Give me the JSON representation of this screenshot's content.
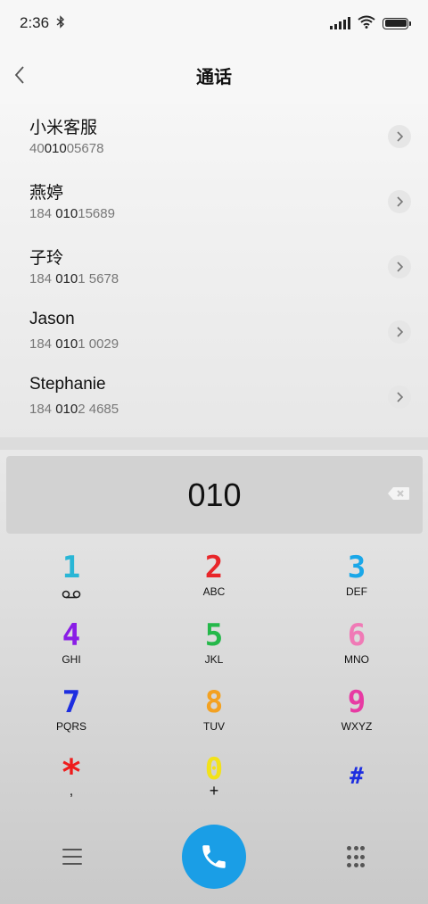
{
  "status_bar": {
    "time": "2:36",
    "bluetooth_icon": "bluetooth-icon",
    "signal_icon": "signal-icon",
    "wifi_icon": "wifi-icon",
    "battery_icon": "battery-icon",
    "battery_level": 1.0
  },
  "header": {
    "title": "通话",
    "back_icon": "chevron-left-icon"
  },
  "contacts": [
    {
      "name": "小米客服",
      "number_parts": [
        "40",
        "010",
        "05678"
      ]
    },
    {
      "name": "燕婷",
      "number_parts": [
        "184 ",
        "010",
        "15689"
      ]
    },
    {
      "name": "子玲",
      "number_parts": [
        "184 ",
        "010",
        "1 5678"
      ]
    },
    {
      "name": "Jason",
      "number_parts": [
        "184 ",
        "010",
        "1 0029"
      ]
    },
    {
      "name": "Stephanie",
      "number_parts": [
        "184 ",
        "010",
        "2 4685"
      ]
    }
  ],
  "dialer": {
    "dialed": "010",
    "backspace_icon": "backspace-icon",
    "keys": [
      {
        "digit": "1",
        "letters": "",
        "sub_icon": "voicemail-icon",
        "color": "#29b6d6"
      },
      {
        "digit": "2",
        "letters": "ABC",
        "color": "#e8262a"
      },
      {
        "digit": "3",
        "letters": "DEF",
        "color": "#1aa7e8"
      },
      {
        "digit": "4",
        "letters": "GHI",
        "color": "#8a1de6"
      },
      {
        "digit": "5",
        "letters": "JKL",
        "color": "#25b84a"
      },
      {
        "digit": "6",
        "letters": "MNO",
        "color": "#f07ab6"
      },
      {
        "digit": "7",
        "letters": "PQRS",
        "color": "#1d2ee0"
      },
      {
        "digit": "8",
        "letters": "TUV",
        "color": "#f3a121"
      },
      {
        "digit": "9",
        "letters": "WXYZ",
        "color": "#e73aa3"
      },
      {
        "digit": "*",
        "letters": ",",
        "color": "#ee1c1c"
      },
      {
        "digit": "0",
        "letters": "+",
        "color": "#f2e21a"
      },
      {
        "digit": "#",
        "letters": "",
        "color": "#1d2ee0"
      }
    ]
  },
  "bottom_bar": {
    "menu_icon": "menu-icon",
    "call_icon": "phone-icon",
    "keypad_icon": "dialpad-icon",
    "call_color": "#1a9ee6"
  }
}
